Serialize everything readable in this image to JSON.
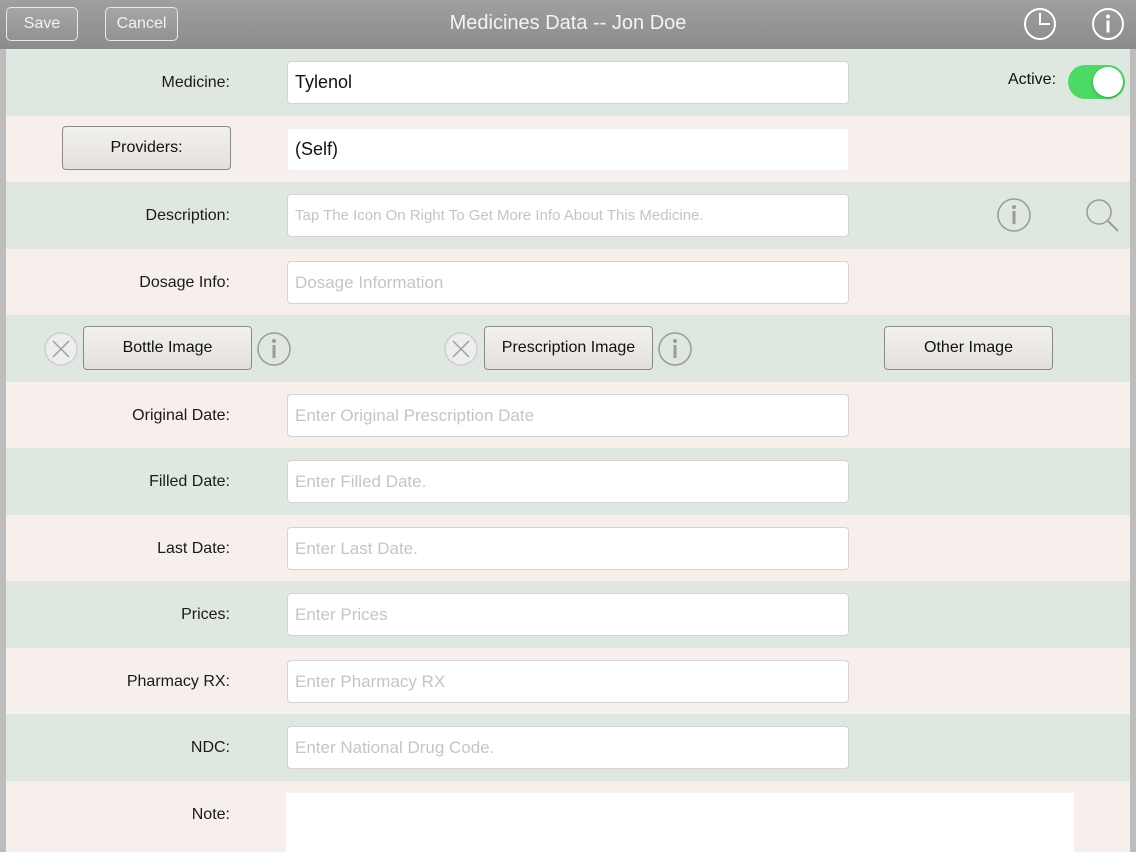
{
  "nav": {
    "save_label": "Save",
    "cancel_label": "Cancel",
    "title": "Medicines Data -- Jon Doe",
    "history_icon": "clock-icon",
    "info_icon": "info-icon"
  },
  "form": {
    "medicine": {
      "label": "Medicine:",
      "value": "Tylenol"
    },
    "active": {
      "label": "Active:",
      "on": true
    },
    "providers": {
      "button_label": "Providers:",
      "value": "(Self)"
    },
    "description": {
      "label": "Description:",
      "placeholder": "Tap The Icon On Right To Get More Info About This Medicine."
    },
    "dosage": {
      "label": "Dosage Info:",
      "placeholder": "Dosage Information"
    },
    "images": {
      "bottle_label": "Bottle Image",
      "prescription_label": "Prescription Image",
      "other_label": "Other Image"
    },
    "original_date": {
      "label": "Original Date:",
      "placeholder": "Enter Original Prescription Date"
    },
    "filled_date": {
      "label": "Filled Date:",
      "placeholder": "Enter Filled Date."
    },
    "last_date": {
      "label": "Last Date:",
      "placeholder": "Enter Last Date."
    },
    "prices": {
      "label": "Prices:",
      "placeholder": "Enter Prices"
    },
    "pharmacy_rx": {
      "label": "Pharmacy RX:",
      "placeholder": "Enter Pharmacy RX"
    },
    "ndc": {
      "label": "NDC:",
      "placeholder": "Enter National Drug Code."
    },
    "note": {
      "label": "Note:",
      "value": ""
    }
  },
  "colors": {
    "row_green": "#dfe8e0",
    "row_pink": "#f6efeb",
    "toggle_on": "#4cd964",
    "navbar": "#959595"
  }
}
